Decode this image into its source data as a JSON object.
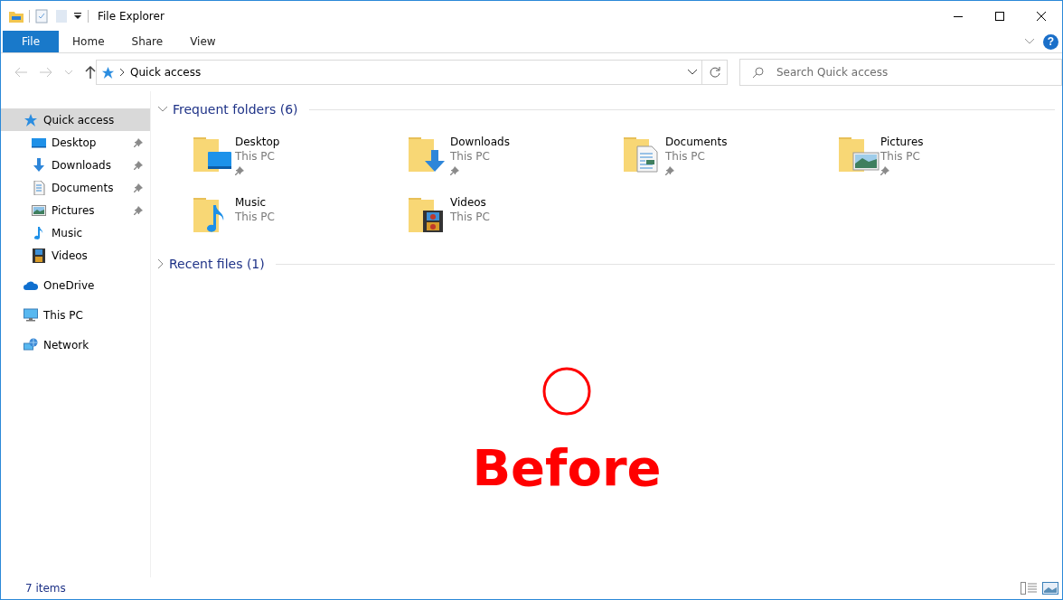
{
  "window": {
    "title": "File Explorer",
    "help": "?"
  },
  "ribbon": {
    "tabs": [
      {
        "label": "File",
        "kind": "file"
      },
      {
        "label": "Home",
        "kind": "tab"
      },
      {
        "label": "Share",
        "kind": "tab"
      },
      {
        "label": "View",
        "kind": "tab"
      }
    ]
  },
  "address_bar": {
    "location": "Quick access"
  },
  "search": {
    "placeholder": "Search Quick access"
  },
  "nav_pane": {
    "items": [
      {
        "label": "Quick access",
        "selected": true,
        "children": [
          {
            "label": "Desktop",
            "selected": false,
            "pinned": true
          },
          {
            "label": "Downloads",
            "selected": false,
            "pinned": true
          },
          {
            "label": "Documents",
            "selected": false,
            "pinned": true
          },
          {
            "label": "Pictures",
            "selected": false,
            "pinned": true
          },
          {
            "label": "Music",
            "selected": false,
            "pinned": false
          },
          {
            "label": "Videos",
            "selected": false,
            "pinned": false
          }
        ]
      },
      {
        "label": "OneDrive",
        "selected": false
      },
      {
        "label": "This PC",
        "selected": false
      },
      {
        "label": "Network",
        "selected": false
      }
    ]
  },
  "content": {
    "sections": [
      {
        "title": "Frequent folders (6)",
        "expanded": true,
        "items": [
          {
            "name": "Desktop",
            "location": "This PC",
            "pinned": true
          },
          {
            "name": "Downloads",
            "location": "This PC",
            "pinned": true
          },
          {
            "name": "Documents",
            "location": "This PC",
            "pinned": true
          },
          {
            "name": "Pictures",
            "location": "This PC",
            "pinned": true
          },
          {
            "name": "Music",
            "location": "This PC",
            "pinned": false
          },
          {
            "name": "Videos",
            "location": "This PC",
            "pinned": false
          }
        ]
      },
      {
        "title": "Recent files (1)",
        "expanded": false
      }
    ]
  },
  "status_bar": {
    "item_count": "7 items"
  },
  "annotation": {
    "label": "Before"
  }
}
